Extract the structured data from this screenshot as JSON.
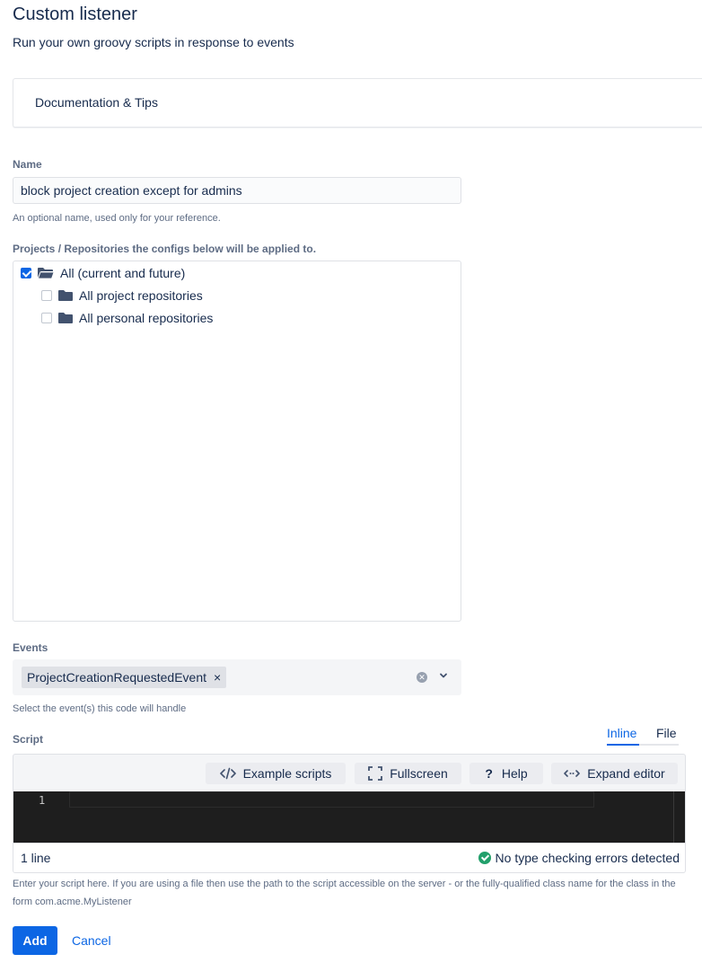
{
  "header": {
    "title": "Custom listener",
    "subtitle": "Run your own groovy scripts in response to events"
  },
  "documentation": {
    "label": "Documentation & Tips"
  },
  "name_field": {
    "label": "Name",
    "value": "block project creation except for admins",
    "helper": "An optional name, used only for your reference."
  },
  "projects": {
    "label": "Projects / Repositories the configs below will be applied to.",
    "items": [
      {
        "label": "All (current and future)",
        "checked": true
      },
      {
        "label": "All project repositories",
        "checked": false
      },
      {
        "label": "All personal repositories",
        "checked": false
      }
    ]
  },
  "events": {
    "label": "Events",
    "selected": [
      "ProjectCreationRequestedEvent"
    ],
    "remove_glyph": "×",
    "helper": "Select the event(s) this code will handle"
  },
  "script": {
    "label": "Script",
    "tabs": [
      {
        "label": "Inline",
        "active": true
      },
      {
        "label": "File",
        "active": false
      }
    ],
    "toolbar": {
      "example": "Example scripts",
      "fullscreen": "Fullscreen",
      "help": "Help",
      "expand": "Expand editor"
    },
    "line_number": "1",
    "status_left": "1 line",
    "status_right": "No type checking errors detected",
    "helper": "Enter your script here. If you are using a file then use the path to the script accessible on the server - or the fully-qualified class name for the class in the form com.acme.MyListener"
  },
  "actions": {
    "add": "Add",
    "cancel": "Cancel"
  },
  "colors": {
    "accent": "#0c66e4",
    "success": "#22a06b",
    "editor_bg": "#1e1e1e"
  }
}
